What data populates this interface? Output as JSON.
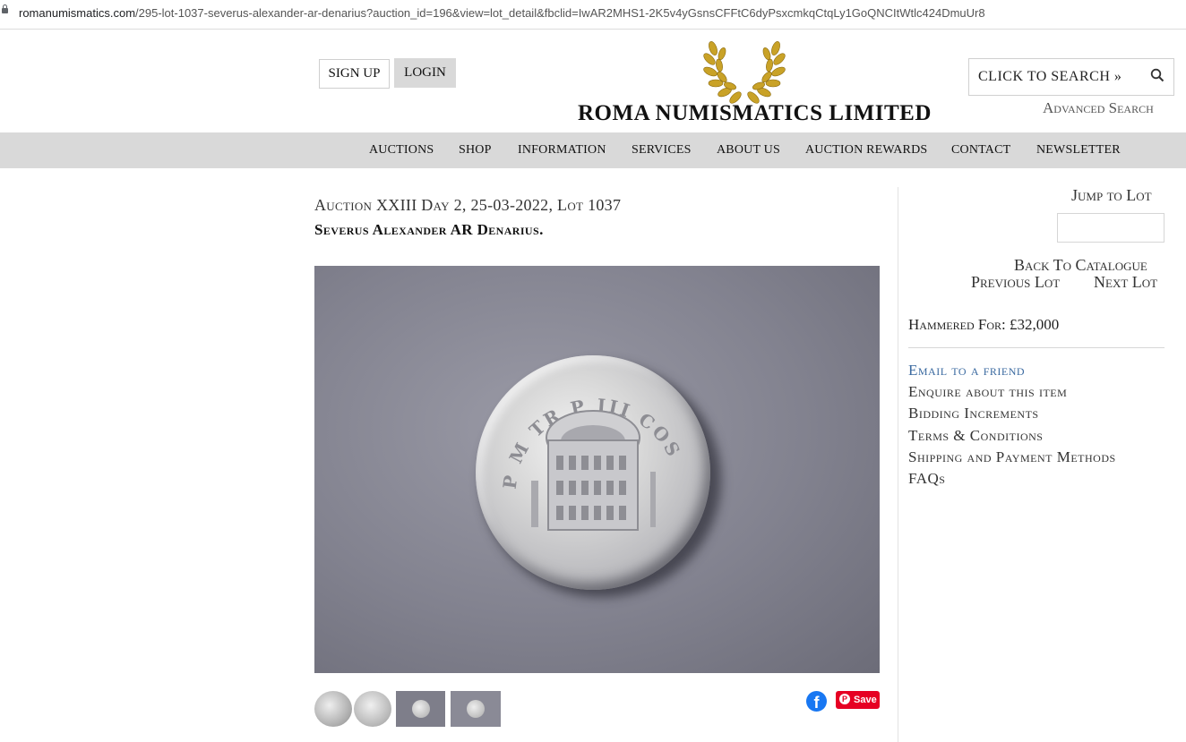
{
  "browser": {
    "url_domain": "romanumismatics.com",
    "url_path": "/295-lot-1037-severus-alexander-ar-denarius?auction_id=196&view=lot_detail&fbclid=IwAR2MHS1-2K5v4yGsnsCFFtC6dyPsxcmkqCtqLy1GoQNCItWtlc424DmuUr8"
  },
  "header": {
    "signup_label": "SIGN UP",
    "login_label": "LOGIN",
    "logo_text": "ROMA NUMISMATICS LIMITED",
    "search_label": "CLICK TO SEARCH »",
    "advanced_search": "Advanced Search"
  },
  "nav": {
    "items": [
      "AUCTIONS",
      "SHOP",
      "INFORMATION",
      "SERVICES",
      "ABOUT US",
      "AUCTION REWARDS",
      "CONTACT",
      "NEWSLETTER"
    ]
  },
  "lot": {
    "heading": "Auction XXIII Day 2, 25-03-2022, Lot 1037",
    "name": "Severus Alexander AR Denarius.",
    "coin_legend": "P M TR P III COS P P"
  },
  "share": {
    "facebook_glyph": "f",
    "pinterest_glyph": "P",
    "pinterest_label": "Save"
  },
  "sidebar": {
    "jump_label": "Jump to Lot",
    "back_label": "Back To Catalogue",
    "prev_label": "Previous Lot",
    "next_label": "Next Lot",
    "hammer_label": "Hammered For: £32,000",
    "links": [
      "Email to a friend",
      "Enquire about this item",
      "Bidding Increments",
      "Terms & Conditions",
      "Shipping and Payment Methods",
      "FAQs"
    ]
  },
  "colors": {
    "nav_bg": "#d9d9d9",
    "link_blue": "#3b6aa0",
    "wreath_gold": "#c9a227",
    "pinterest_red": "#e60023",
    "facebook_blue": "#1877f2"
  },
  "icons": [
    "lock-icon",
    "wreath-logo",
    "search-icon",
    "facebook-icon",
    "pinterest-icon"
  ]
}
